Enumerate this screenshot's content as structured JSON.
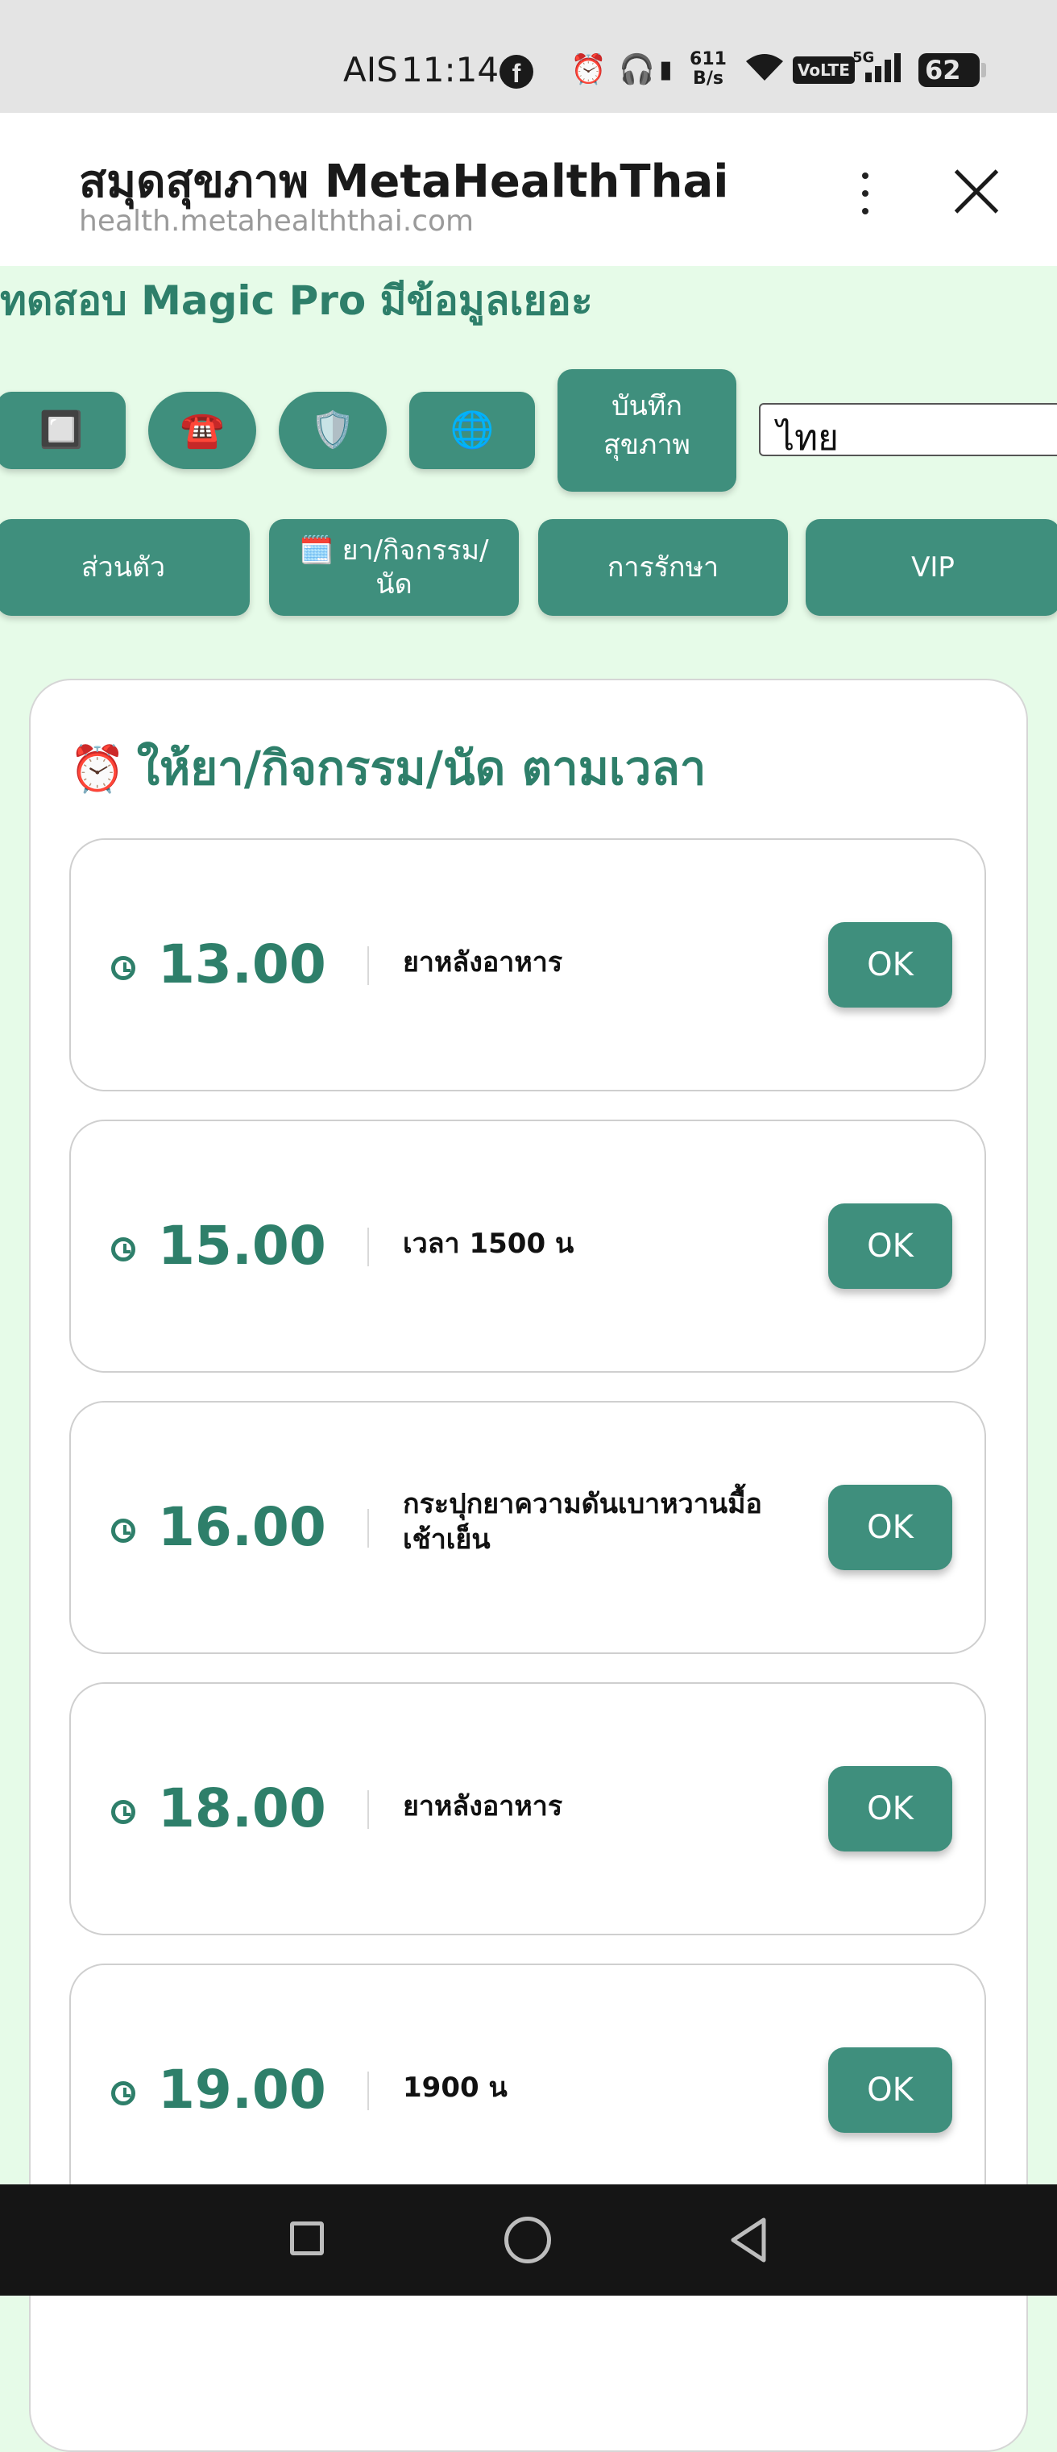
{
  "status_bar": {
    "carrier": "AIS",
    "time": "11:14",
    "network_speed": "611\nB/s",
    "network_speed_value": "611",
    "network_speed_unit": "B/s",
    "volte": "VoLTE",
    "network_type": "5G",
    "battery": "62"
  },
  "header": {
    "title": "สมุดสุขภาพ MetaHealthThai",
    "url": "health.metahealththai.com"
  },
  "page": {
    "heading": "ทดสอบ Magic Pro มีข้อมูลเยอะ"
  },
  "toolbar": {
    "icon_buttons": [
      {
        "icon": "🔲",
        "name": "square-button-icon"
      },
      {
        "icon": "☎️",
        "name": "telephone-icon"
      },
      {
        "icon": "🛡️",
        "name": "shield-icon"
      },
      {
        "icon": "🌐",
        "name": "globe-icon"
      }
    ],
    "record_label_line1": "บันทึก",
    "record_label_line2": "สุขภาพ",
    "language_selected": "ไทย"
  },
  "tabs": {
    "personal": "ส่วนตัว",
    "meds_icon": "🗓️",
    "meds_line1": "ยา/กิจกรรม/",
    "meds_line2": "นัด",
    "treatment": "การรักษา",
    "vip": "VIP"
  },
  "schedule": {
    "title_icon": "⏰",
    "title": "ให้ยา/กิจกรรม/นัด ตามเวลา",
    "ok_label": "OK",
    "items": [
      {
        "time": "13.00",
        "description": "ยาหลังอาหาร"
      },
      {
        "time": "15.00",
        "description": "เวลา 1500 น"
      },
      {
        "time": "16.00",
        "description_line1": "กระปุกยาความดันเบาหวานมื้อ",
        "description_line2": "เช้าเย็น"
      },
      {
        "time": "18.00",
        "description": "ยาหลังอาหาร"
      },
      {
        "time": "19.00",
        "description": "1900 น"
      }
    ]
  },
  "colors": {
    "accent": "#3f8f7d",
    "heading_green": "#2e7f6a",
    "page_background": "#e6fbe8"
  }
}
